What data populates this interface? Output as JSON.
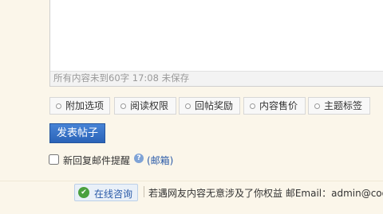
{
  "editor": {
    "status_text": "所有内容未到60字 17:08 未保存"
  },
  "options": [
    {
      "label": "附加选项"
    },
    {
      "label": "阅读权限"
    },
    {
      "label": "回帖奖励"
    },
    {
      "label": "内容售价"
    },
    {
      "label": "主题标签"
    }
  ],
  "submit": {
    "label": "发表帖子"
  },
  "notify": {
    "label": "新回复邮件提醒",
    "checked": false,
    "help_icon": "question-icon",
    "mailbox_link": "(邮箱)"
  },
  "footer": {
    "online_label": "在线咨询",
    "online_icon": "chat-icon",
    "notice": "若遇网友内容无意涉及了你权益 邮Email：admin@coov"
  },
  "colors": {
    "page_bg": "#fbf6ea",
    "submit_bg": "#2a63b8",
    "link": "#2a5aa8"
  }
}
